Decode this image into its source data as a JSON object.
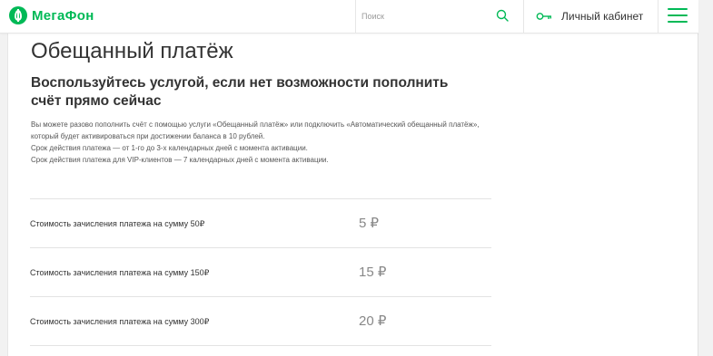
{
  "header": {
    "logo_text": "МегаФон",
    "search_placeholder": "Поиск",
    "cabinet_label": "Личный кабинет"
  },
  "main": {
    "title": "Обещанный платёж",
    "subtitle": "Воспользуйтесь услугой, если нет возможности пополнить счёт прямо сейчас",
    "description": [
      "Вы можете разово пополнить счёт с помощью услуги «Обещанный платёж» или подключить «Автоматический обещанный платёж», который будет активироваться при достижении баланса в 10 рублей.",
      "Срок действия платежа — от 1-го до 3-х календарных дней с момента активации.",
      "Срок действия платежа для VIP-клиентов — 7 календарных дней с момента активации."
    ],
    "prices": [
      {
        "label": "Стоимость зачисления платежа на сумму 50₽",
        "value": "5 ₽"
      },
      {
        "label": "Стоимость зачисления платежа на сумму 150₽",
        "value": "15 ₽"
      },
      {
        "label": "Стоимость зачисления платежа на сумму 300₽",
        "value": "20 ₽"
      }
    ]
  },
  "colors": {
    "brand_green": "#00b956",
    "text_dark": "#333333",
    "text_muted": "#888888"
  },
  "icons": {
    "logo": "megafon-logo-icon",
    "search": "search-icon",
    "cabinet": "key-icon",
    "menu": "hamburger-menu-icon"
  }
}
